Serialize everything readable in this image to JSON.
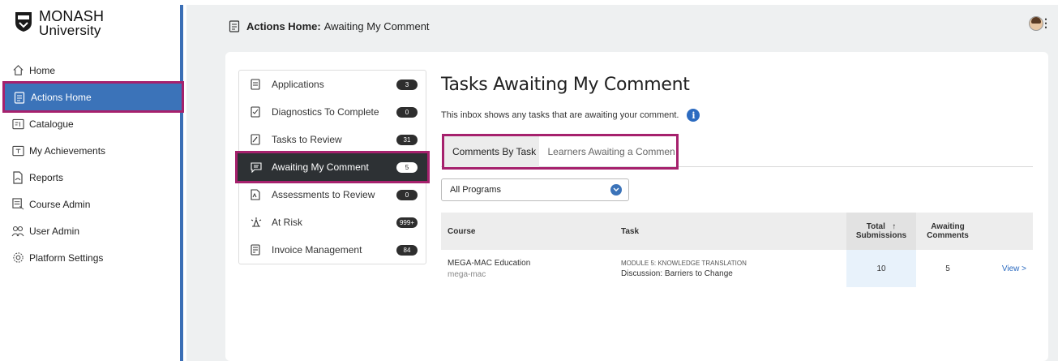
{
  "brand": {
    "line1": "MONASH",
    "line2": "University"
  },
  "sidebar": {
    "items": [
      {
        "label": "Home",
        "icon": "home-icon"
      },
      {
        "label": "Actions Home",
        "icon": "clipboard-icon",
        "active": true
      },
      {
        "label": "Catalogue",
        "icon": "catalogue-icon"
      },
      {
        "label": "My Achievements",
        "icon": "achievements-icon"
      },
      {
        "label": "Reports",
        "icon": "reports-icon"
      },
      {
        "label": "Course Admin",
        "icon": "course-admin-icon"
      },
      {
        "label": "User Admin",
        "icon": "users-icon"
      },
      {
        "label": "Platform Settings",
        "icon": "gear-icon"
      }
    ]
  },
  "header": {
    "section": "Actions Home:",
    "page": "Awaiting My Comment"
  },
  "tasks": [
    {
      "label": "Applications",
      "count": "3"
    },
    {
      "label": "Diagnostics To Complete",
      "count": "0"
    },
    {
      "label": "Tasks to Review",
      "count": "31"
    },
    {
      "label": "Awaiting My Comment",
      "count": "5",
      "active": true
    },
    {
      "label": "Assessments to Review",
      "count": "0"
    },
    {
      "label": "At Risk",
      "count": "999+"
    },
    {
      "label": "Invoice Management",
      "count": "84"
    }
  ],
  "main": {
    "title": "Tasks Awaiting My Comment",
    "description": "This inbox shows any tasks that are awaiting your comment.",
    "tabs": [
      "Comments By Task",
      "Learners Awaiting a Commen"
    ],
    "filter": "All Programs",
    "table": {
      "headers": {
        "course": "Course",
        "task": "Task",
        "total": "Total",
        "total2": "Submissions",
        "sort": "↑",
        "awaiting": "Awaiting",
        "awaiting2": "Comments"
      },
      "rows": [
        {
          "course": "MEGA-MAC Education",
          "course_code": "mega-mac",
          "module": "MODULE 5: KNOWLEDGE TRANSLATION",
          "task": "Discussion: Barriers to Change",
          "total": "10",
          "awaiting": "5",
          "action": "View >"
        }
      ]
    }
  },
  "colors": {
    "accent": "#3b73b9",
    "highlight": "#a6216d",
    "active_task": "#2d3134"
  }
}
